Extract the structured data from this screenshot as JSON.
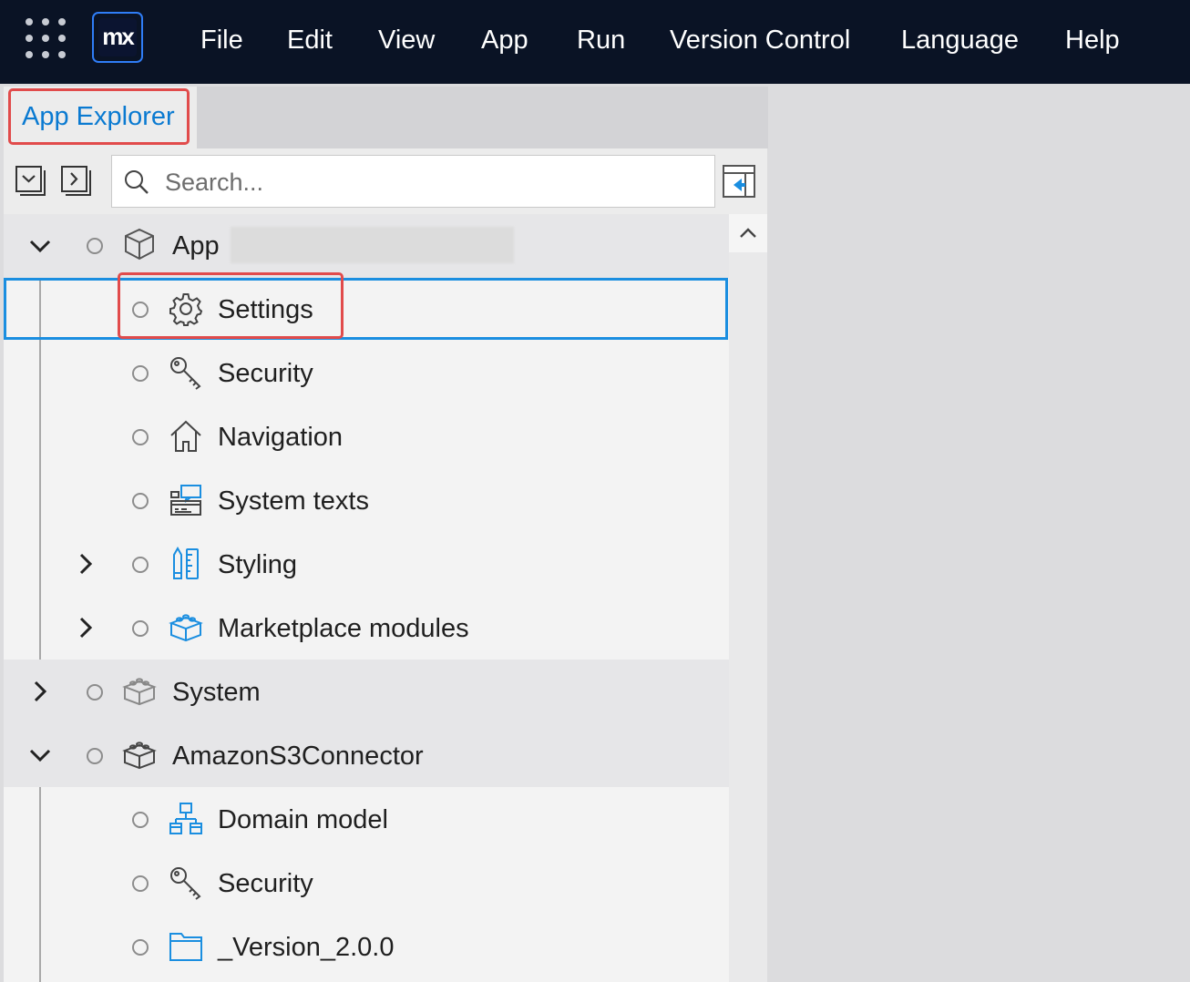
{
  "menubar": {
    "logo_text": "mx",
    "items": [
      "File",
      "Edit",
      "View",
      "App",
      "Run",
      "Version Control",
      "Language",
      "Help"
    ]
  },
  "panel": {
    "title": "App Explorer",
    "search_placeholder": "Search..."
  },
  "tree": {
    "app_label": "App",
    "app_children": [
      "Settings",
      "Security",
      "Navigation",
      "System texts",
      "Styling",
      "Marketplace modules"
    ],
    "system_label": "System",
    "module_label": "AmazonS3Connector",
    "module_children": [
      "Domain model",
      "Security",
      "_Version_2.0.0"
    ]
  },
  "colors": {
    "menubar_bg": "#0a1325",
    "accent_blue": "#1a8ee0",
    "highlight_red": "#e14b4b",
    "tree_bg": "#f3f3f3"
  },
  "icons": [
    "apps-grid-icon",
    "collapse-all-icon",
    "expand-all-icon",
    "search-icon",
    "dock-panel-icon",
    "chevron-up-icon",
    "cube-icon",
    "gear-icon",
    "key-icon",
    "home-icon",
    "system-texts-icon",
    "styling-icon",
    "marketplace-module-icon",
    "module-icon",
    "domain-model-icon",
    "folder-icon"
  ]
}
